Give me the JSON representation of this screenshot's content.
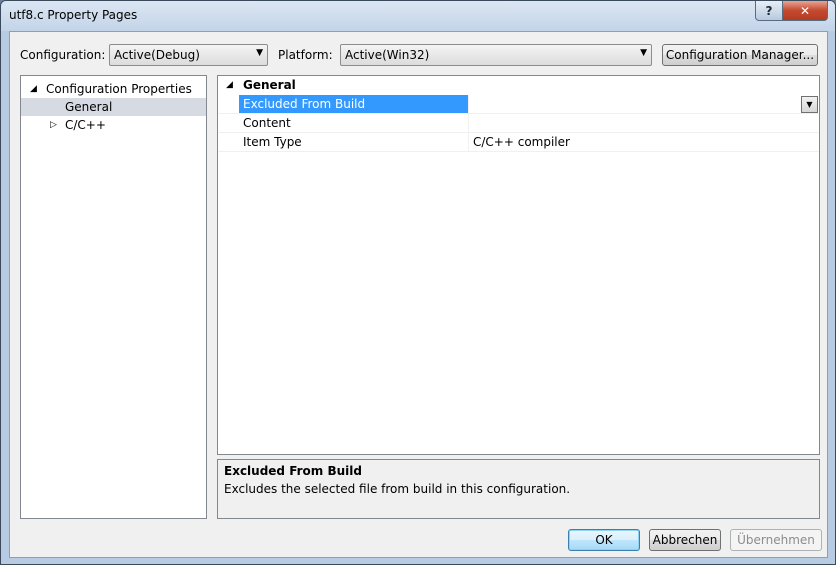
{
  "window": {
    "title": "utf8.c Property Pages",
    "help_label": "?",
    "close_label": "✕"
  },
  "toolbar": {
    "configuration_label": "Configuration:",
    "configuration_value": "Active(Debug)",
    "platform_label": "Platform:",
    "platform_value": "Active(Win32)",
    "config_manager_label": "Configuration Manager..."
  },
  "tree": {
    "root": "Configuration Properties",
    "items": [
      {
        "label": "General",
        "selected": true
      },
      {
        "label": "C/C++",
        "selected": false
      }
    ]
  },
  "grid": {
    "category": "General",
    "rows": [
      {
        "name": "Excluded From Build",
        "value": "",
        "selected": true
      },
      {
        "name": "Content",
        "value": "",
        "selected": false
      },
      {
        "name": "Item Type",
        "value": "C/C++ compiler",
        "selected": false
      }
    ]
  },
  "description": {
    "title": "Excluded From Build",
    "text": "Excludes the selected file from build in this configuration."
  },
  "buttons": {
    "ok": "OK",
    "cancel": "Abbrechen",
    "apply": "Übernehmen"
  },
  "icons": {
    "expanded": "triangle-down",
    "collapsed": "triangle-right",
    "dropdown": "chevron-down"
  },
  "colors": {
    "selection": "#3399ff",
    "tree_selection": "#d6dbe3"
  }
}
